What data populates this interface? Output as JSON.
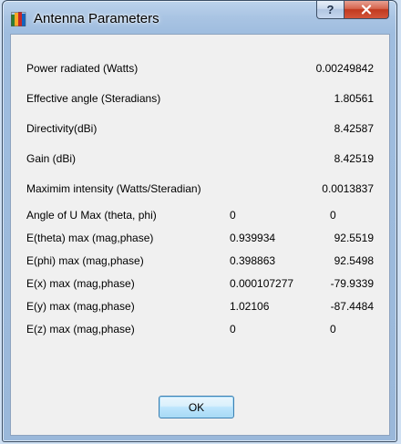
{
  "window": {
    "title": "Antenna Parameters",
    "help_label": "?",
    "close_label": "x"
  },
  "params": [
    {
      "label": "Power radiated (Watts)",
      "value": "0.00249842"
    },
    {
      "label": "Effective angle (Steradians)",
      "value": "1.80561"
    },
    {
      "label": "Directivity(dBi)",
      "value": "8.42587"
    },
    {
      "label": "Gain (dBi)",
      "value": "8.42519"
    },
    {
      "label": "Maximim intensity (Watts/Steradian)",
      "value": "0.0013837"
    }
  ],
  "fields": [
    {
      "label": "Angle of U Max (theta, phi)",
      "v1": "0",
      "v2": "0"
    },
    {
      "label": "E(theta) max (mag,phase)",
      "v1": "0.939934",
      "v2": "92.5519"
    },
    {
      "label": "E(phi) max (mag,phase)",
      "v1": "0.398863",
      "v2": "92.5498"
    },
    {
      "label": "E(x) max (mag,phase)",
      "v1": "0.000107277",
      "v2": "-79.9339"
    },
    {
      "label": "E(y) max (mag,phase)",
      "v1": "1.02106",
      "v2": "-87.4484"
    },
    {
      "label": "E(z) max (mag,phase)",
      "v1": "0",
      "v2": "0"
    }
  ],
  "ok_label": "OK"
}
